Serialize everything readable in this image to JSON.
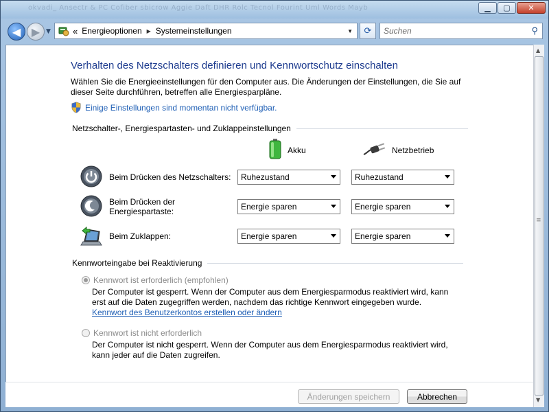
{
  "titlebar": {
    "ghost_text": "okvadi_ Ansectr & PC  Cofiber  sbicrow  Aggie  Daft  DHR  Rolc  Tecnol  Fourint  Uml  Words  Mayb"
  },
  "window_controls": {
    "minimize": "▁",
    "maximize": "▢",
    "close": "✕"
  },
  "nav": {
    "back_icon": "◀",
    "forward_icon": "▶",
    "history_dropdown": "▼",
    "address_prefix": "«",
    "breadcrumb": [
      "Energieoptionen",
      "Systemeinstellungen"
    ],
    "refresh_icon": "⟳",
    "search_placeholder": "Suchen"
  },
  "page": {
    "title": "Verhalten des Netzschalters definieren und Kennwortschutz einschalten",
    "description": "Wählen Sie die Energieeinstellungen für den Computer aus. Die Änderungen der Einstellungen, die Sie auf dieser Seite durchführen, betreffen alle Energiesparpläne.",
    "admin_link": "Einige Einstellungen sind momentan nicht verfügbar."
  },
  "power_section": {
    "heading": "Netzschalter-, Energiespartasten- und Zuklappeinstellungen",
    "column_battery": "Akku",
    "column_plugged": "Netzbetrieb",
    "rows": [
      {
        "label": "Beim Drücken des Netzschalters:",
        "battery": "Ruhezustand",
        "plugged": "Ruhezustand",
        "icon": "power-button-icon"
      },
      {
        "label": "Beim Drücken der Energiespartaste:",
        "battery": "Energie sparen",
        "plugged": "Energie sparen",
        "icon": "sleep-button-icon"
      },
      {
        "label": "Beim Zuklappen:",
        "battery": "Energie sparen",
        "plugged": "Energie sparen",
        "icon": "laptop-lid-icon"
      }
    ]
  },
  "password_section": {
    "heading": "Kennworteingabe bei Reaktivierung",
    "options": [
      {
        "label": "Kennwort ist erforderlich (empfohlen)",
        "checked": true,
        "description": "Der Computer ist gesperrt. Wenn der Computer aus dem Energiesparmodus reaktiviert wird, kann erst auf die Daten zugegriffen werden, nachdem das richtige Kennwort eingegeben wurde.",
        "link": "Kennwort des Benutzerkontos erstellen oder ändern"
      },
      {
        "label": "Kennwort ist nicht erforderlich",
        "checked": false,
        "description": "Der Computer ist nicht gesperrt. Wenn der Computer aus dem Energiesparmodus reaktiviert wird, kann jeder auf die Daten zugreifen."
      }
    ]
  },
  "footer": {
    "save_label": "Änderungen speichern",
    "cancel_label": "Abbrechen"
  },
  "colors": {
    "title": "#1e3c8f",
    "link": "#1f5fb5"
  }
}
